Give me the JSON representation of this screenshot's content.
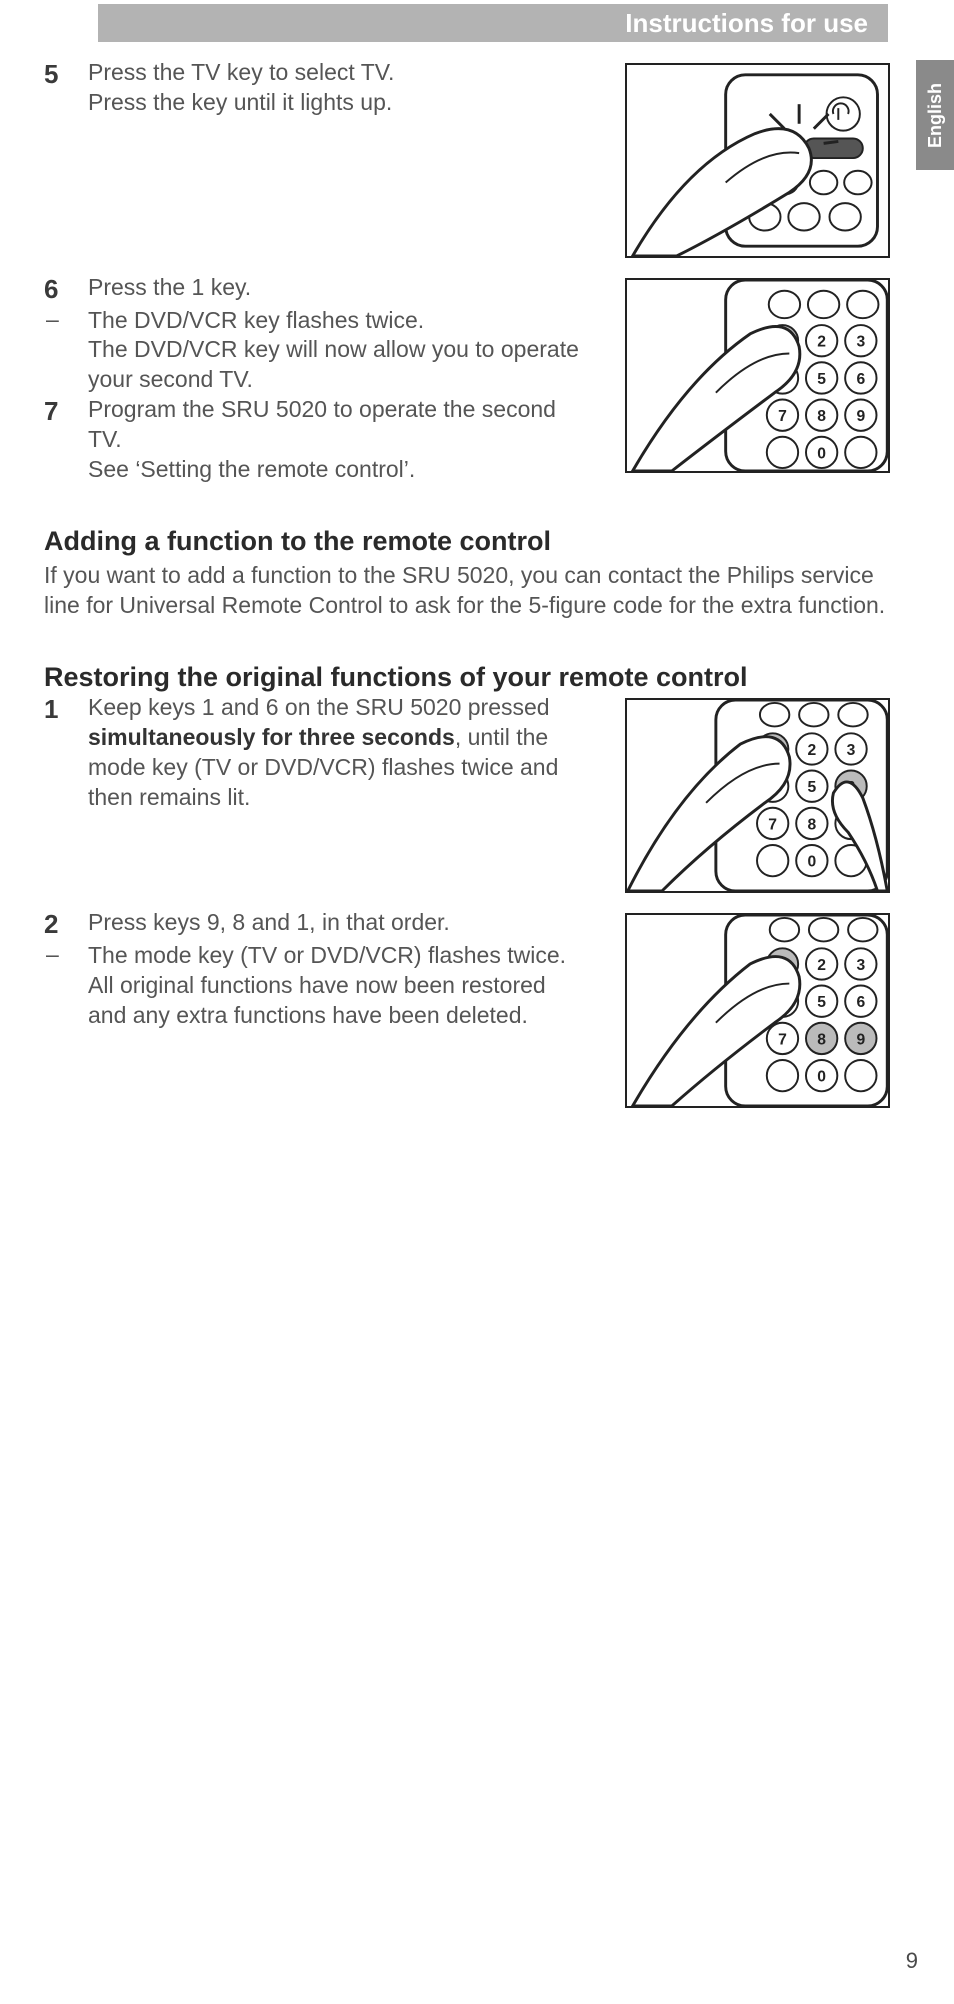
{
  "header": {
    "title": "Instructions for use"
  },
  "language_tab": "English",
  "steps_upper": {
    "s5": {
      "num": "5",
      "line1": "Press the TV key to select TV.",
      "line2": "Press the key until it lights up."
    },
    "s6": {
      "num": "6",
      "line1": "Press the 1 key.",
      "dash_line": "The DVD/VCR key flashes twice.",
      "line3": "The DVD/VCR key will now allow you to operate your second TV."
    },
    "s7": {
      "num": "7",
      "line1": "Program the SRU 5020 to operate the second TV.",
      "line2": "See ‘Setting the remote control’."
    }
  },
  "section_add": {
    "heading": "Adding a function to the remote control",
    "para": "If you want to add a function to the SRU 5020, you can contact the Philips service line for Universal Remote Control to ask for the 5-figure code for the extra function."
  },
  "section_restore": {
    "heading": "Restoring the original functions of your remote control",
    "s1": {
      "num": "1",
      "line_pre": "Keep keys 1 and 6 on the SRU 5020 pressed ",
      "bold": "simultaneously for three seconds",
      "line_post": ", until the mode key (TV or DVD/VCR) flashes twice and then remains lit."
    },
    "s2": {
      "num": "2",
      "line1": "Press keys 9, 8 and 1, in that order.",
      "dash_line": "The mode key (TV or DVD/VCR) flashes twice.",
      "line3": "All original functions have now been restored and any extra functions have been deleted."
    }
  },
  "page_number": "9"
}
